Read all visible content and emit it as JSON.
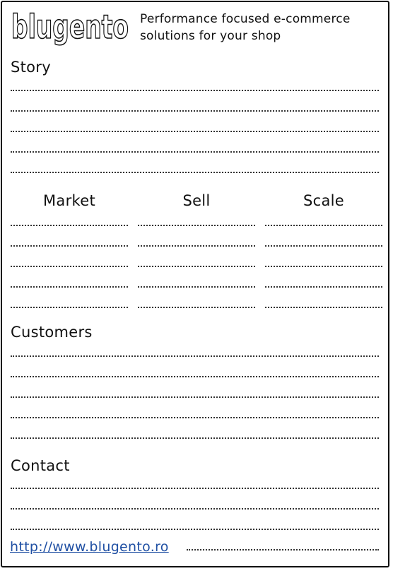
{
  "brand": {
    "logo_text": "blugento"
  },
  "tagline": "Performance focused e-commerce solutions for your shop",
  "sections": {
    "story": "Story",
    "columns": [
      "Market",
      "Sell",
      "Scale"
    ],
    "customers": "Customers",
    "contact": "Contact"
  },
  "contact_link": "http://www.blugento.ro"
}
